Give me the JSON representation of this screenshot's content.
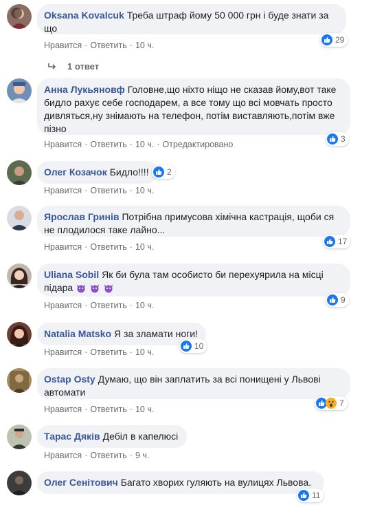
{
  "actions": {
    "like": "Нравится",
    "reply": "Ответить",
    "edited": "Отредактировано"
  },
  "comments": [
    {
      "author": "Oksana Kovalcuk",
      "text": "Треба штраф йому 50 000 грн і буде знати за що",
      "time": "10 ч.",
      "likes": "29"
    },
    {
      "author": "Анна Лукьяновф",
      "text": "Головне,що ніхто ніщо не сказав йому,вот таке бидло рахує себе господарем, а все тому що всі мовчать просто дивляться,ну знімають на телефон, потім виставляють,потім вже пізно",
      "time": "10 ч.",
      "likes": "3"
    },
    {
      "author": "Олег Козачок",
      "text": "Бидло!!!!",
      "time": "10 ч.",
      "likes": "2"
    },
    {
      "author": "Ярослав Гринів",
      "text": "Потрібна примусова хімічна кастрація, щоби ся не плодилося таке лайно...",
      "time": "10 ч.",
      "likes": "17"
    },
    {
      "author": "Uliana Sobil",
      "text": "Як би була там особисто би перехуярила на місці підара",
      "time": "10 ч.",
      "likes": "9"
    },
    {
      "author": "Natalia Matsko",
      "text": "Я за зламати ноги!",
      "time": "10 ч.",
      "likes": "10"
    },
    {
      "author": "Ostap Osty",
      "text": "Думаю, що він заплатить за всі понищені у Львові автомати",
      "time": "10 ч.",
      "likes": "7"
    },
    {
      "author": "Тарас Дяків",
      "text": "Дебіл в капелюсі",
      "time": "9 ч.",
      "likes": ""
    },
    {
      "author": "Олег Сенітович",
      "text": "Багато хворих гуляють на вулицях Львова.",
      "time": "10 ч.",
      "likes": "11"
    }
  ],
  "replies": {
    "label": "1 ответ"
  },
  "icons": {
    "like": "thumbs-up-icon",
    "wow": "wow-face-icon",
    "devil": "devil-emoji-icon",
    "reply_arrow": "reply-arrow-icon"
  },
  "colors": {
    "author": "#385898",
    "bubble": "#f0f2f5",
    "like": "#1877f2",
    "meta": "#65676b"
  }
}
